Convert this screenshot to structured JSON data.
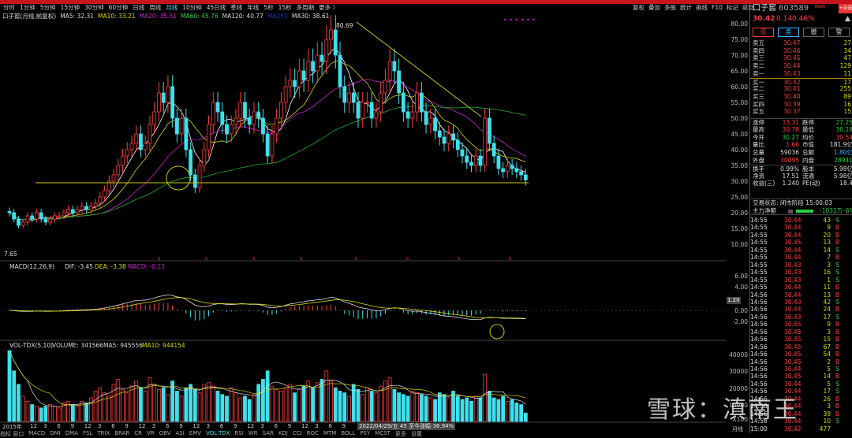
{
  "toolbar": {
    "periods": [
      "分时",
      "1分钟",
      "5分钟",
      "15分钟",
      "30分钟",
      "60分钟",
      "日线",
      "周线",
      "月线",
      "10分钟",
      "45日线",
      "季线",
      "年线",
      "5秒",
      "15秒",
      "多周期",
      "更多 〉"
    ],
    "active": "月线",
    "right": [
      "复权",
      "叠加",
      "多股",
      "统计",
      "画线",
      "F10",
      "标记",
      "返回"
    ]
  },
  "legend": {
    "name": "口子窖(月线,前复权)",
    "ma5": "MA5: 32.31",
    "ma10": "MA10: 33.21",
    "ma20": "MA20: 35.51",
    "ma60": "MA60: 45.76",
    "ma120": "MA120: 40.77",
    "ma250": "MA250",
    "ma30": "MA30: 38.61"
  },
  "annotations": {
    "high": "80.69",
    "low": "7.65",
    "tooltip": "2022/04/29/五 45 至今涨幅-36.94%",
    "macd_marker": "1.20"
  },
  "macd_legend": {
    "name": "MACD(12,26,9)",
    "dif": "DIF: -3.45",
    "dea": "DEA: -3.38",
    "macd": "MACD: -0.13"
  },
  "vol_legend": {
    "name": "VOL-TDX(5,10)",
    "volume": "VOLUME: 341566",
    "ma5": "MA5: 945556",
    "ma10": "MA10: 944154"
  },
  "price_axis": [
    "80.00",
    "75.00",
    "70.00",
    "65.00",
    "60.00",
    "55.00",
    "50.00",
    "45.00",
    "40.00",
    "35.00",
    "30.00",
    "25.00",
    "20.00",
    "15.00",
    "10.00"
  ],
  "macd_axis": [
    "6.00",
    "4.00",
    "0.00",
    "-2.00"
  ],
  "vol_axis": [
    "40000",
    "30000",
    "20000",
    "10000",
    "X100"
  ],
  "x_axis": [
    "2015年",
    "12",
    "3",
    "6",
    "9",
    "12",
    "3",
    "6",
    "9",
    "12",
    "3",
    "6",
    "9",
    "12",
    "3",
    "6",
    "9",
    "12",
    "3",
    "6",
    "9",
    "12",
    "3",
    "6",
    "9",
    "12",
    "3",
    "6",
    "9",
    "12",
    "3",
    "6",
    "9",
    "12"
  ],
  "period_label": "月线",
  "bottom_tabs": [
    "指标 窗口",
    "MACD",
    "DMI",
    "DMA",
    "FSL",
    "TRIX",
    "BRAR",
    "CR",
    "VR",
    "OBV",
    "ASI",
    "EMV",
    "VOL-TDX",
    "RSI",
    "WR",
    "SAR",
    "KDJ",
    "CCI",
    "ROC",
    "MTM",
    "BOLL",
    "PSY",
    "MCST",
    "更多",
    "设置"
  ],
  "quote": {
    "name": "口子窖",
    "code": "603589",
    "tag": "R500",
    "price": "30.42",
    "change": "0.14",
    "pct": "0.46%",
    "add_btn": "+自选",
    "buttons": [
      "买",
      "卖",
      "撤",
      "警"
    ],
    "asks": [
      [
        "卖五",
        "30.47",
        "27"
      ],
      [
        "卖四",
        "30.46",
        "34"
      ],
      [
        "卖三",
        "30.45",
        "47"
      ],
      [
        "卖二",
        "30.44",
        "129"
      ],
      [
        "卖一",
        "30.43",
        "11"
      ]
    ],
    "bids": [
      [
        "买一",
        "30.42",
        "17"
      ],
      [
        "买二",
        "30.41",
        "255"
      ],
      [
        "买三",
        "30.40",
        "89"
      ],
      [
        "买四",
        "30.39",
        "16"
      ],
      [
        "买五",
        "30.37",
        "15"
      ]
    ],
    "stats": [
      [
        "涨停",
        "33.31",
        "跌停",
        "27.25"
      ],
      [
        "最高",
        "30.78",
        "最低",
        "30.18"
      ],
      [
        "今开",
        "30.27",
        "均价",
        "30.54"
      ],
      [
        "量比",
        "1.66",
        "市值",
        "181.9亿"
      ],
      [
        "总量",
        "59036",
        "总额",
        "1.80亿"
      ],
      [
        "外盘",
        "30095",
        "内盘",
        "28941"
      ],
      [
        "换手",
        "0.99%",
        "股本",
        "5.98亿"
      ],
      [
        "净资",
        "17.51",
        "流通",
        "5.98亿"
      ],
      [
        "收益(三)",
        "1.240",
        "PE(动)",
        "18.4"
      ]
    ],
    "status": "交易状态: 闭市阶段 15:00:03",
    "flow_label": "主力净额",
    "flow_value": "-1031万",
    "flow_pct": "-6%"
  },
  "trades": [
    [
      "14:55",
      "30.44",
      "43",
      "S"
    ],
    [
      "14:55",
      "30.44",
      "9",
      "B"
    ],
    [
      "14:55",
      "30.44",
      "20",
      "B"
    ],
    [
      "14:55",
      "30.45",
      "13",
      "B"
    ],
    [
      "14:55",
      "30.44",
      "14",
      "S"
    ],
    [
      "14:55",
      "30.44",
      "7",
      "B"
    ],
    [
      "14:55",
      "30.43",
      "3",
      "S"
    ],
    [
      "14:55",
      "30.43",
      "16",
      "S"
    ],
    [
      "14:55",
      "30.43",
      "1",
      "S"
    ],
    [
      "14:55",
      "30.44",
      "11",
      "B"
    ],
    [
      "14:56",
      "30.44",
      "13",
      "B"
    ],
    [
      "14:56",
      "30.43",
      "42",
      "S"
    ],
    [
      "14:56",
      "30.44",
      "24",
      "B"
    ],
    [
      "14:56",
      "30.43",
      "17",
      "S"
    ],
    [
      "14:56",
      "30.45",
      "9",
      "B"
    ],
    [
      "14:56",
      "30.45",
      "3",
      "B"
    ],
    [
      "14:56",
      "30.45",
      "15",
      "B"
    ],
    [
      "14:56",
      "30.45",
      "67",
      "B"
    ],
    [
      "14:56",
      "30.45",
      "54",
      "B"
    ],
    [
      "14:56",
      "30.45",
      "2",
      "B"
    ],
    [
      "14:56",
      "30.44",
      "5",
      "S"
    ],
    [
      "14:56",
      "30.45",
      "14",
      "B"
    ],
    [
      "14:56",
      "30.44",
      "5",
      "S"
    ],
    [
      "14:56",
      "30.44",
      "17",
      "S"
    ],
    [
      "14:56",
      "30.44",
      "26",
      "B"
    ],
    [
      "14:56",
      "30.44",
      "3",
      "B"
    ],
    [
      "14:56",
      "30.44",
      "39",
      "B"
    ],
    [
      "14:56",
      "30.44",
      "10",
      "S"
    ],
    [
      "15:00",
      "30.42",
      "477",
      ""
    ]
  ],
  "watermark": "雪球：滇南王",
  "colors": {
    "up": "#ff3c3c",
    "down": "#3ee0ee",
    "ma5": "#ffffff",
    "ma10": "#d8d800",
    "ma20": "#d020d0",
    "ma60": "#20b020",
    "trend": "#c8c800"
  },
  "chart_data": {
    "type": "candlestick",
    "period": "monthly",
    "start": "2015-06",
    "end": "2024-12",
    "close": [
      20,
      18,
      16,
      17,
      19,
      18,
      20,
      18,
      17,
      18,
      19,
      19,
      20,
      21,
      20,
      21,
      22,
      21,
      22,
      23,
      25,
      27,
      30,
      32,
      35,
      38,
      40,
      42,
      45,
      40,
      42,
      48,
      52,
      58,
      55,
      60,
      50,
      45,
      50,
      40,
      32,
      28,
      35,
      40,
      48,
      55,
      52,
      48,
      45,
      48,
      50,
      55,
      50,
      48,
      52,
      50,
      45,
      38,
      45,
      50,
      55,
      60,
      62,
      60,
      65,
      62,
      68,
      65,
      70,
      68,
      75,
      78,
      70,
      60,
      55,
      58,
      55,
      50,
      55,
      55,
      50,
      52,
      58,
      62,
      68,
      65,
      58,
      52,
      50,
      52,
      58,
      52,
      48,
      50,
      46,
      44,
      42,
      45,
      43,
      40,
      38,
      36,
      35,
      38,
      35,
      50,
      42,
      38,
      34,
      33,
      35,
      34,
      33,
      32,
      30.42
    ],
    "volume": [
      42000,
      30000,
      22000,
      15000,
      12000,
      10000,
      9000,
      8000,
      9000,
      10000,
      9000,
      8000,
      11000,
      12000,
      10000,
      9000,
      12000,
      11000,
      14000,
      18000,
      20000,
      17000,
      15000,
      22000,
      25000,
      19000,
      17000,
      21000,
      24000,
      20000,
      18000,
      26000,
      22000,
      19000,
      20000,
      16000,
      24000,
      18000,
      15000,
      20000,
      22000,
      19000,
      17000,
      22000,
      23000,
      21000,
      18000,
      16000,
      15000,
      20000,
      17000,
      14000,
      15000,
      13000,
      16000,
      22000,
      25000,
      30000,
      21000,
      19000,
      18000,
      20000,
      22000,
      17000,
      19000,
      21000,
      24000,
      20000,
      23000,
      25000,
      30000,
      24000,
      20000,
      18000,
      17000,
      15000,
      22000,
      19000,
      16000,
      20000,
      18000,
      17000,
      21000,
      24000,
      26000,
      19000,
      17000,
      16000,
      15000,
      18000,
      17000,
      16000,
      15000,
      14000,
      13000,
      17000,
      16000,
      14000,
      18000,
      15000,
      13000,
      14000,
      12000,
      15000,
      14000,
      28000,
      18000,
      14000,
      13000,
      15000,
      12000,
      13000,
      11000,
      10000,
      5000
    ],
    "ylim": [
      5,
      80
    ]
  }
}
